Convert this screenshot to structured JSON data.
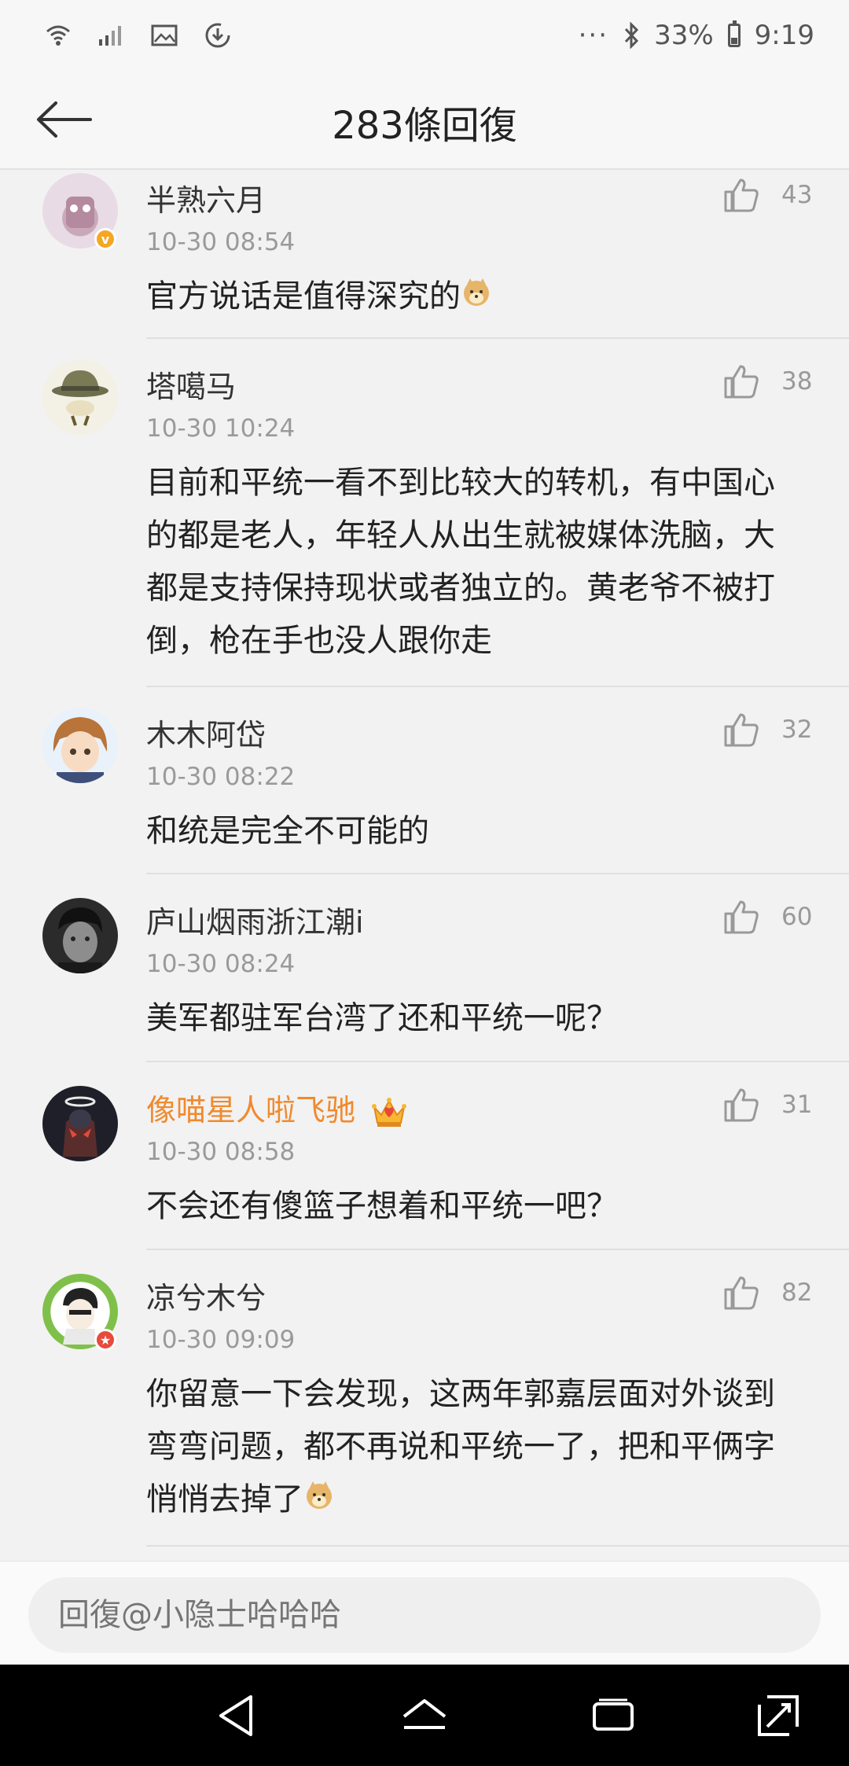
{
  "status_bar": {
    "battery": "33%",
    "time": "9:19",
    "icons": [
      "wifi-icon",
      "signal-icon",
      "image-icon",
      "download-icon",
      "more-dots-icon",
      "bluetooth-icon",
      "battery-icon"
    ]
  },
  "header": {
    "title": "283條回復",
    "back_icon": "arrow-left-icon"
  },
  "comments": [
    {
      "name": "半熟六月",
      "time": "10-30 08:54",
      "likes": "43",
      "lines": [
        "官方说话是值得深究的"
      ],
      "emoji_end": true,
      "vip": false,
      "badge": "v"
    },
    {
      "name": "塔噶马",
      "time": "10-30 10:24",
      "likes": "38",
      "lines": [
        "目前和平统一看不到比较大的转机，有中国心",
        "的都是老人，年轻人从出生就被媒体洗脑，大",
        "都是支持保持现状或者独立的。黄老爷不被打",
        "倒，枪在手也没人跟你走"
      ],
      "emoji_end": false,
      "vip": false
    },
    {
      "name": "木木阿岱",
      "time": "10-30 08:22",
      "likes": "32",
      "lines": [
        "和统是完全不可能的"
      ],
      "emoji_end": false,
      "vip": false
    },
    {
      "name": "庐山烟雨浙江潮i",
      "time": "10-30 08:24",
      "likes": "60",
      "lines": [
        "美军都驻军台湾了还和平统一呢？"
      ],
      "emoji_end": false,
      "vip": false
    },
    {
      "name": "像喵星人啦飞驰",
      "time": "10-30 08:58",
      "likes": "31",
      "lines": [
        "不会还有傻篮子想着和平统一吧？"
      ],
      "emoji_end": false,
      "vip": true
    },
    {
      "name": "凉兮木兮",
      "time": "10-30 09:09",
      "likes": "82",
      "lines": [
        "你留意一下会发现，这两年郭嘉层面对外谈到",
        "弯弯问题，都不再说和平统一了，把和平俩字",
        "悄悄去掉了"
      ],
      "emoji_end": true,
      "vip": false,
      "badge": "★"
    }
  ],
  "reply_bar": {
    "placeholder": "回復@小隐士哈哈哈"
  },
  "nav": [
    "back-nav-icon",
    "home-nav-icon",
    "recents-nav-icon",
    "rotate-nav-icon"
  ],
  "colors": {
    "vip_name": "#f08a2e",
    "badge_v": "#f5a623",
    "badge_star": "#e84a3c"
  }
}
